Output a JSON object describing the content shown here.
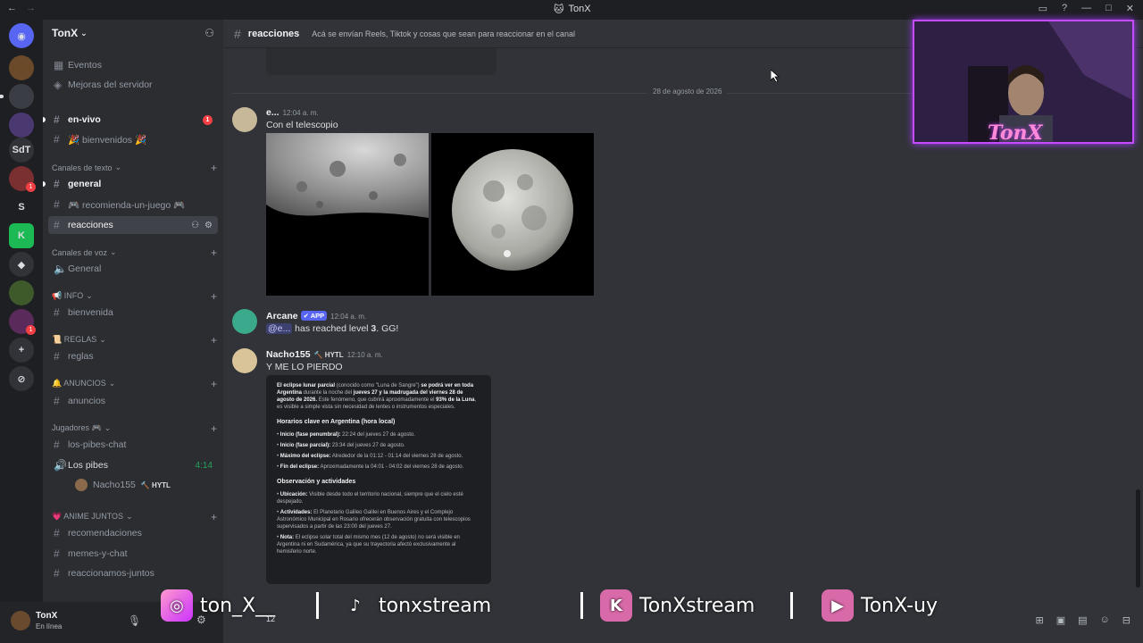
{
  "window": {
    "title": "TonX"
  },
  "servers": [
    "SdT",
    "S"
  ],
  "server": {
    "name": "TonX"
  },
  "sidebar": {
    "top_items": [
      {
        "label": "Eventos"
      },
      {
        "label": "Mejoras del servidor"
      }
    ],
    "channels": [
      {
        "label": "en-vivo",
        "badge": "1"
      },
      {
        "label": "🎉 bienvenidos 🎉"
      }
    ],
    "cat_text": "Canales de texto",
    "text_channels": [
      "general",
      "🎮 recomienda-un-juego 🎮",
      "reacciones"
    ],
    "cat_voice": "Canales de voz",
    "voice_channels": [
      "General"
    ],
    "cat_info": "📢 INFO",
    "info_channels": [
      "bienvenida"
    ],
    "cat_rules": "📜 REGLAS",
    "rules_channels": [
      "reglas"
    ],
    "cat_ann": "🔔 ANUNCIOS",
    "ann_channels": [
      "anuncios"
    ],
    "cat_players": "Jugadores 🎮",
    "players_channels": [
      "los-pibes-chat"
    ],
    "voice2": {
      "label": "Los pibes",
      "time": "4:14"
    },
    "voice_user": {
      "name": "Nacho155",
      "tag": "🔨 HYTL"
    },
    "cat_anime": "💗 ANIME JUNTOS",
    "anime_channels": [
      "recomendaciones",
      "memes-y-chat",
      "reaccionamos-juntos"
    ]
  },
  "user": {
    "name": "TonX",
    "status": "En línea"
  },
  "channel": {
    "name": "reacciones",
    "topic": "Acá se envían Reels, Tiktok y cosas que sean para reaccionar en el canal"
  },
  "messages": {
    "date": "28 de agosto de 2026",
    "m1": {
      "author": "e...",
      "time": "12:04 a. m.",
      "text": "Con el telescopio"
    },
    "m2": {
      "author": "Arcane",
      "app": "✔ APP",
      "time": "12:04 a. m.",
      "mention": "@e...",
      "text_pre": " has reached level ",
      "level": "3",
      "text_post": ". GG!"
    },
    "m3": {
      "author": "Nacho155",
      "tag": "🔨 HYTL",
      "time": "12:10 a. m.",
      "text": "Y ME LO PIERDO"
    }
  },
  "card": {
    "intro_b1": "El eclipse lunar parcial",
    "intro_1": " (conocido como \"Luna de Sangre\") ",
    "intro_b2": "se podrá ver en toda Argentina",
    "intro_2": " durante la noche del ",
    "intro_b3": "jueves 27 y la madrugada del viernes 28 de agosto de 2026.",
    "intro_3": " Este fenómeno, que cubrirá aproximadamente el ",
    "intro_b4": "93% de la Luna",
    "intro_4": ", es visible a simple vista sin necesidad de lentes o instrumentos especiales.",
    "h1": "Horarios clave en Argentina (hora local)",
    "times": [
      {
        "k": "Inicio (fase penumbral):",
        "v": " 22:24 del jueves 27 de agosto."
      },
      {
        "k": "Inicio (fase parcial):",
        "v": " 23:34 del jueves 27 de agosto."
      },
      {
        "k": "Máximo del eclipse:",
        "v": " Alrededor de la 01:12 - 01:14 del viernes 28 de agosto."
      },
      {
        "k": "Fin del eclipse:",
        "v": " Aproximadamente la 04:01 - 04:02 del viernes 28 de agosto."
      }
    ],
    "h2": "Observación y actividades",
    "obs": [
      {
        "k": "Ubicación:",
        "v": " Visible desde todo el territorio nacional, siempre que el cielo esté despejado."
      },
      {
        "k": "Actividades:",
        "v": " El Planetario Galileo Galilei en Buenos Aires y el Complejo Astronómico Municipal en Rosario ofrecerán observación gratuita con telescopios supervisados a partir de las 23:00 del jueves 27."
      },
      {
        "k": "Nota:",
        "v": " El eclipse solar total del mismo mes (12 de agosto) no será visible en Argentina ni en Sudamérica, ya que su trayectoria afectó exclusivamente al hemisferio norte."
      }
    ]
  },
  "overlay": {
    "webcam_name": "TonX",
    "socials": [
      {
        "handle": "ton_X__",
        "icon": "instagram-icon"
      },
      {
        "handle": "tonxstream",
        "icon": "tiktok-icon"
      },
      {
        "handle": "TonXstream",
        "icon": "kick-icon"
      },
      {
        "handle": "TonX-uy",
        "icon": "youtube-icon"
      }
    ],
    "count": "12"
  }
}
